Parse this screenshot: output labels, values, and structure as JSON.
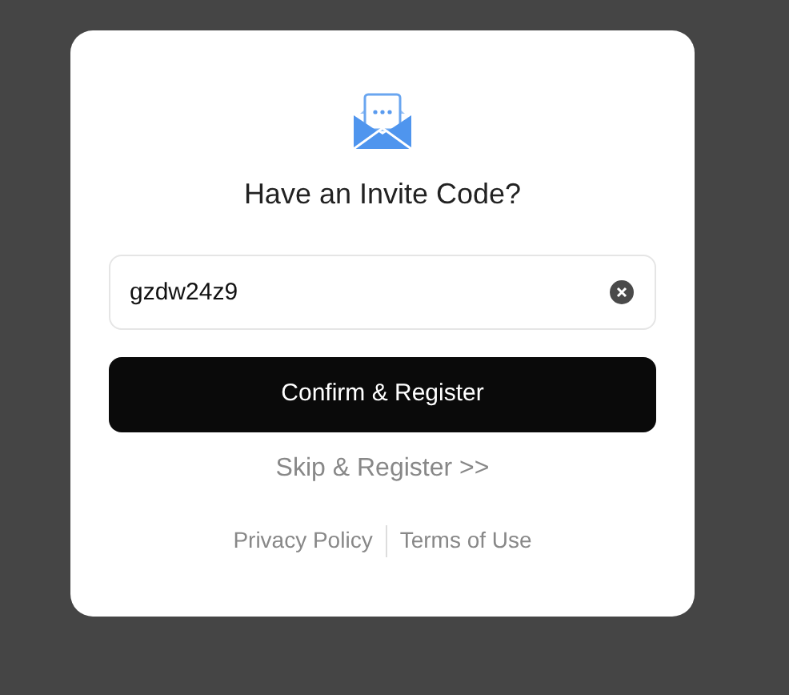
{
  "dialog": {
    "title": "Have an Invite Code?",
    "invite_field": {
      "value": "gzdw24z9"
    },
    "confirm_button": "Confirm & Register",
    "skip_link": "Skip & Register >>",
    "footer_links": [
      "Privacy Policy",
      "Terms of Use"
    ]
  }
}
